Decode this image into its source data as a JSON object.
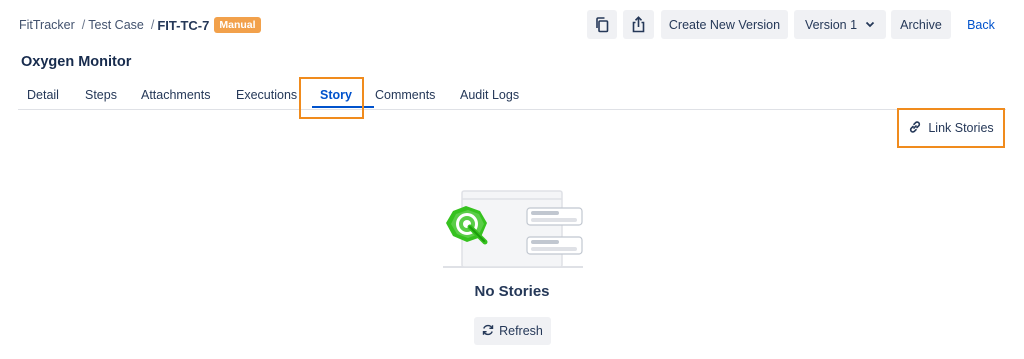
{
  "breadcrumb": {
    "app": "FitTracker",
    "section": "Test Case",
    "key": "FIT-TC-7",
    "badge": "Manual"
  },
  "toolbar": {
    "copy_icon": "copy-icon",
    "share_icon": "share-icon",
    "create_version": "Create New Version",
    "version": "Version 1",
    "archive": "Archive",
    "back": "Back"
  },
  "page": {
    "title": "Oxygen Monitor"
  },
  "tabs": [
    {
      "label": "Detail",
      "active": false
    },
    {
      "label": "Steps",
      "active": false
    },
    {
      "label": "Attachments",
      "active": false
    },
    {
      "label": "Executions",
      "active": false
    },
    {
      "label": "Story",
      "active": true
    },
    {
      "label": "Comments",
      "active": false
    },
    {
      "label": "Audit Logs",
      "active": false
    }
  ],
  "story_panel": {
    "link_button": "Link Stories",
    "empty_title": "No Stories",
    "refresh_button": "Refresh"
  },
  "colors": {
    "accent": "#0052cc",
    "badge": "#f2a14b",
    "highlight": "#f08b1d",
    "illustration_green": "#36c21f"
  }
}
